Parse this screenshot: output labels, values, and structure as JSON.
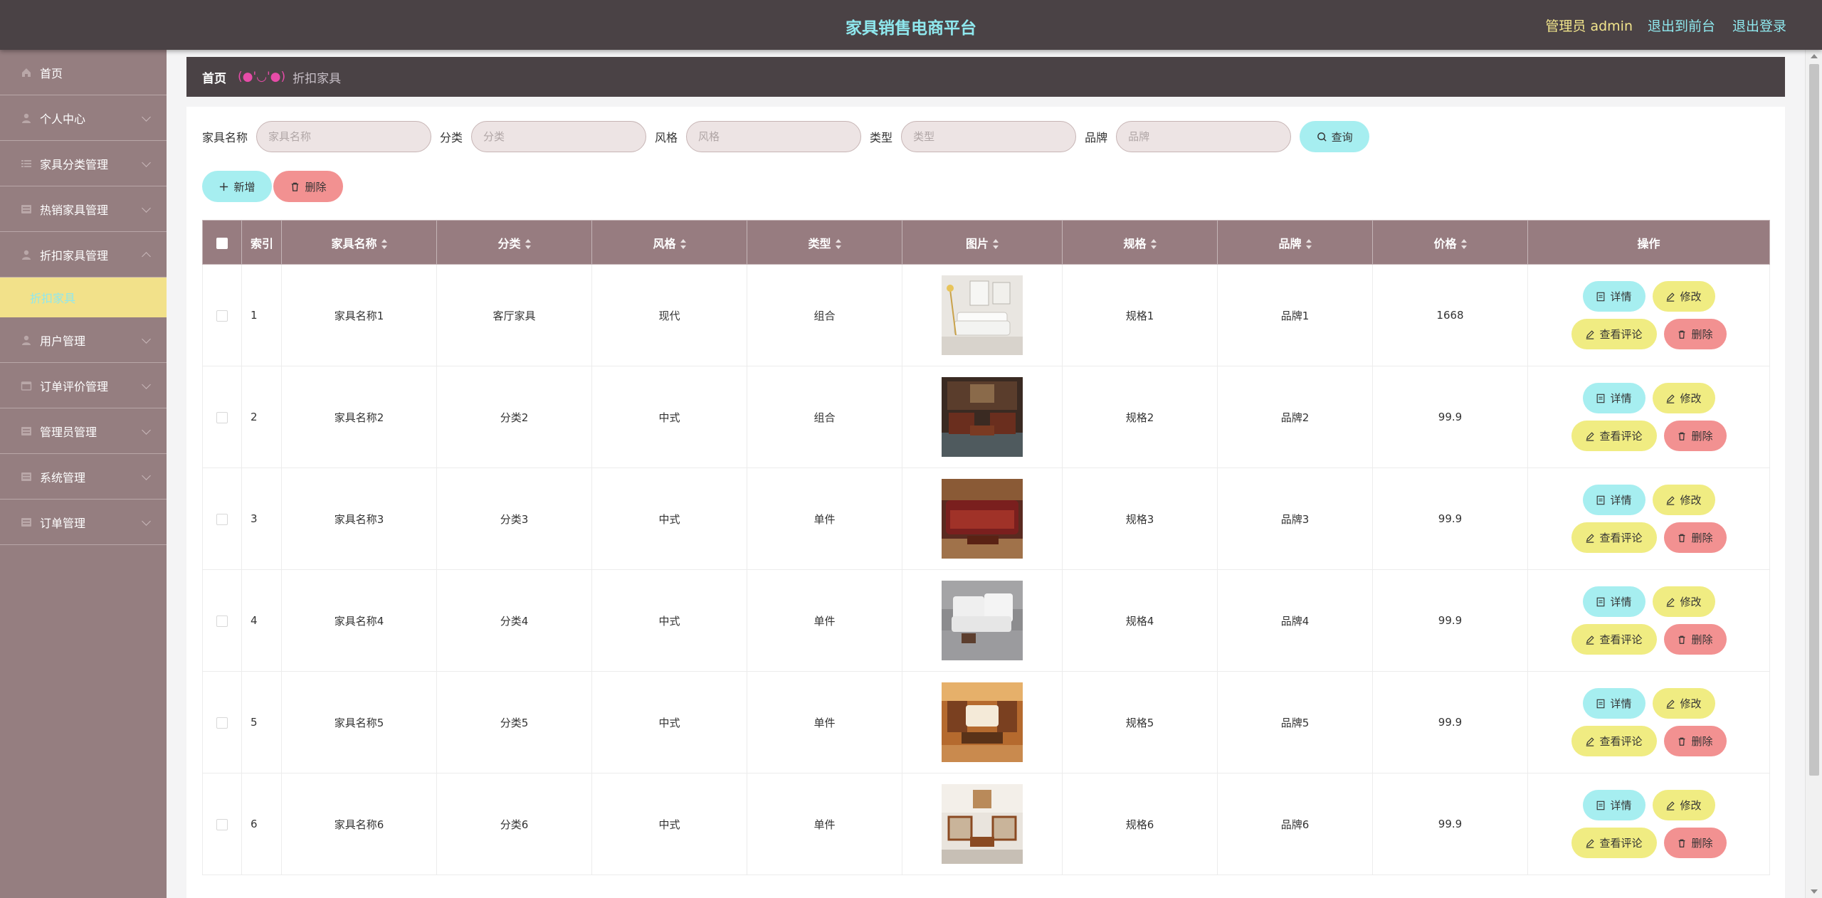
{
  "header": {
    "title": "家具销售电商平台",
    "user_label": "管理员 admin",
    "front_link": "退出到前台",
    "logout_link": "退出登录"
  },
  "sidebar": {
    "items": [
      {
        "label": "首页",
        "icon": "home-icon",
        "has_children": false
      },
      {
        "label": "个人中心",
        "icon": "user-icon",
        "has_children": true
      },
      {
        "label": "家具分类管理",
        "icon": "list-icon",
        "has_children": true
      },
      {
        "label": "热销家具管理",
        "icon": "grid-icon",
        "has_children": true
      },
      {
        "label": "折扣家具管理",
        "icon": "user-icon",
        "has_children": true,
        "expanded": true,
        "children": [
          {
            "label": "折扣家具"
          }
        ]
      },
      {
        "label": "用户管理",
        "icon": "user-icon",
        "has_children": true
      },
      {
        "label": "订单评价管理",
        "icon": "calendar-icon",
        "has_children": true
      },
      {
        "label": "管理员管理",
        "icon": "grid-icon",
        "has_children": true
      },
      {
        "label": "系统管理",
        "icon": "grid-icon",
        "has_children": true
      },
      {
        "label": "订单管理",
        "icon": "grid-icon",
        "has_children": true
      }
    ]
  },
  "breadcrumb": {
    "home": "首页",
    "face": "(●'◡'●)",
    "current": "折扣家具"
  },
  "search": {
    "fields": [
      {
        "label": "家具名称",
        "placeholder": "家具名称"
      },
      {
        "label": "分类",
        "placeholder": "分类"
      },
      {
        "label": "风格",
        "placeholder": "风格"
      },
      {
        "label": "类型",
        "placeholder": "类型"
      },
      {
        "label": "品牌",
        "placeholder": "品牌"
      }
    ],
    "query_button": "查询"
  },
  "toolbar": {
    "add_button": "新增",
    "delete_button": "删除"
  },
  "table": {
    "columns": [
      "索引",
      "家具名称",
      "分类",
      "风格",
      "类型",
      "图片",
      "规格",
      "品牌",
      "价格",
      "操作"
    ],
    "rows": [
      {
        "index": "1",
        "name": "家具名称1",
        "category": "客厅家具",
        "style": "现代",
        "type": "组合",
        "spec": "规格1",
        "brand": "品牌1",
        "price": "1668",
        "image": "white-sofa-image"
      },
      {
        "index": "2",
        "name": "家具名称2",
        "category": "分类2",
        "style": "中式",
        "type": "组合",
        "spec": "规格2",
        "brand": "品牌2",
        "price": "99.9",
        "image": "chinese-living-room-image"
      },
      {
        "index": "3",
        "name": "家具名称3",
        "category": "分类3",
        "style": "中式",
        "type": "单件",
        "spec": "规格3",
        "brand": "品牌3",
        "price": "99.9",
        "image": "red-wood-sofa-image"
      },
      {
        "index": "4",
        "name": "家具名称4",
        "category": "分类4",
        "style": "中式",
        "type": "单件",
        "spec": "规格4",
        "brand": "品牌4",
        "price": "99.9",
        "image": "white-armchair-image"
      },
      {
        "index": "5",
        "name": "家具名称5",
        "category": "分类5",
        "style": "中式",
        "type": "单件",
        "spec": "规格5",
        "brand": "品牌5",
        "price": "99.9",
        "image": "warm-living-room-image"
      },
      {
        "index": "6",
        "name": "家具名称6",
        "category": "分类6",
        "style": "中式",
        "type": "单件",
        "spec": "规格6",
        "brand": "品牌6",
        "price": "99.9",
        "image": "wood-frame-sofa-image"
      }
    ],
    "row_actions": {
      "detail": "详情",
      "edit": "修改",
      "review": "查看评论",
      "delete": "删除"
    }
  },
  "colors": {
    "topbar": "#4a4245",
    "sidebar": "#957e80",
    "accent_cyan": "#8fe8ee",
    "accent_yellow": "#f2e18a",
    "table_header": "#977c80",
    "button_cyan": "#a6eef0",
    "button_yellow": "#f0ec82",
    "button_red": "#f29191"
  }
}
